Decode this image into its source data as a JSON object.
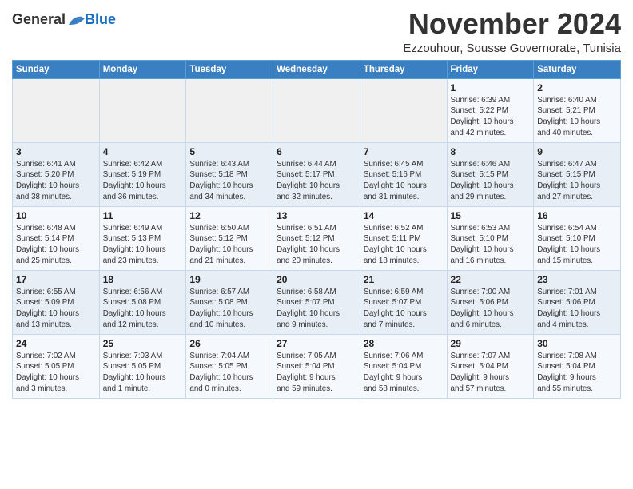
{
  "header": {
    "logo_general": "General",
    "logo_blue": "Blue",
    "month_title": "November 2024",
    "location": "Ezzouhour, Sousse Governorate, Tunisia"
  },
  "calendar": {
    "headers": [
      "Sunday",
      "Monday",
      "Tuesday",
      "Wednesday",
      "Thursday",
      "Friday",
      "Saturday"
    ],
    "weeks": [
      [
        {
          "day": "",
          "info": ""
        },
        {
          "day": "",
          "info": ""
        },
        {
          "day": "",
          "info": ""
        },
        {
          "day": "",
          "info": ""
        },
        {
          "day": "",
          "info": ""
        },
        {
          "day": "1",
          "info": "Sunrise: 6:39 AM\nSunset: 5:22 PM\nDaylight: 10 hours\nand 42 minutes."
        },
        {
          "day": "2",
          "info": "Sunrise: 6:40 AM\nSunset: 5:21 PM\nDaylight: 10 hours\nand 40 minutes."
        }
      ],
      [
        {
          "day": "3",
          "info": "Sunrise: 6:41 AM\nSunset: 5:20 PM\nDaylight: 10 hours\nand 38 minutes."
        },
        {
          "day": "4",
          "info": "Sunrise: 6:42 AM\nSunset: 5:19 PM\nDaylight: 10 hours\nand 36 minutes."
        },
        {
          "day": "5",
          "info": "Sunrise: 6:43 AM\nSunset: 5:18 PM\nDaylight: 10 hours\nand 34 minutes."
        },
        {
          "day": "6",
          "info": "Sunrise: 6:44 AM\nSunset: 5:17 PM\nDaylight: 10 hours\nand 32 minutes."
        },
        {
          "day": "7",
          "info": "Sunrise: 6:45 AM\nSunset: 5:16 PM\nDaylight: 10 hours\nand 31 minutes."
        },
        {
          "day": "8",
          "info": "Sunrise: 6:46 AM\nSunset: 5:15 PM\nDaylight: 10 hours\nand 29 minutes."
        },
        {
          "day": "9",
          "info": "Sunrise: 6:47 AM\nSunset: 5:15 PM\nDaylight: 10 hours\nand 27 minutes."
        }
      ],
      [
        {
          "day": "10",
          "info": "Sunrise: 6:48 AM\nSunset: 5:14 PM\nDaylight: 10 hours\nand 25 minutes."
        },
        {
          "day": "11",
          "info": "Sunrise: 6:49 AM\nSunset: 5:13 PM\nDaylight: 10 hours\nand 23 minutes."
        },
        {
          "day": "12",
          "info": "Sunrise: 6:50 AM\nSunset: 5:12 PM\nDaylight: 10 hours\nand 21 minutes."
        },
        {
          "day": "13",
          "info": "Sunrise: 6:51 AM\nSunset: 5:12 PM\nDaylight: 10 hours\nand 20 minutes."
        },
        {
          "day": "14",
          "info": "Sunrise: 6:52 AM\nSunset: 5:11 PM\nDaylight: 10 hours\nand 18 minutes."
        },
        {
          "day": "15",
          "info": "Sunrise: 6:53 AM\nSunset: 5:10 PM\nDaylight: 10 hours\nand 16 minutes."
        },
        {
          "day": "16",
          "info": "Sunrise: 6:54 AM\nSunset: 5:10 PM\nDaylight: 10 hours\nand 15 minutes."
        }
      ],
      [
        {
          "day": "17",
          "info": "Sunrise: 6:55 AM\nSunset: 5:09 PM\nDaylight: 10 hours\nand 13 minutes."
        },
        {
          "day": "18",
          "info": "Sunrise: 6:56 AM\nSunset: 5:08 PM\nDaylight: 10 hours\nand 12 minutes."
        },
        {
          "day": "19",
          "info": "Sunrise: 6:57 AM\nSunset: 5:08 PM\nDaylight: 10 hours\nand 10 minutes."
        },
        {
          "day": "20",
          "info": "Sunrise: 6:58 AM\nSunset: 5:07 PM\nDaylight: 10 hours\nand 9 minutes."
        },
        {
          "day": "21",
          "info": "Sunrise: 6:59 AM\nSunset: 5:07 PM\nDaylight: 10 hours\nand 7 minutes."
        },
        {
          "day": "22",
          "info": "Sunrise: 7:00 AM\nSunset: 5:06 PM\nDaylight: 10 hours\nand 6 minutes."
        },
        {
          "day": "23",
          "info": "Sunrise: 7:01 AM\nSunset: 5:06 PM\nDaylight: 10 hours\nand 4 minutes."
        }
      ],
      [
        {
          "day": "24",
          "info": "Sunrise: 7:02 AM\nSunset: 5:05 PM\nDaylight: 10 hours\nand 3 minutes."
        },
        {
          "day": "25",
          "info": "Sunrise: 7:03 AM\nSunset: 5:05 PM\nDaylight: 10 hours\nand 1 minute."
        },
        {
          "day": "26",
          "info": "Sunrise: 7:04 AM\nSunset: 5:05 PM\nDaylight: 10 hours\nand 0 minutes."
        },
        {
          "day": "27",
          "info": "Sunrise: 7:05 AM\nSunset: 5:04 PM\nDaylight: 9 hours\nand 59 minutes."
        },
        {
          "day": "28",
          "info": "Sunrise: 7:06 AM\nSunset: 5:04 PM\nDaylight: 9 hours\nand 58 minutes."
        },
        {
          "day": "29",
          "info": "Sunrise: 7:07 AM\nSunset: 5:04 PM\nDaylight: 9 hours\nand 57 minutes."
        },
        {
          "day": "30",
          "info": "Sunrise: 7:08 AM\nSunset: 5:04 PM\nDaylight: 9 hours\nand 55 minutes."
        }
      ]
    ]
  }
}
